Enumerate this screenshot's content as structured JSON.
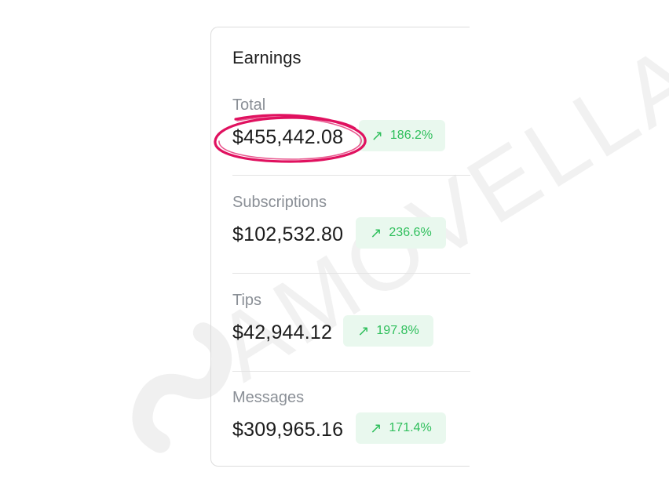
{
  "watermark": {
    "text": "AMOVELLA",
    "color": "#f2f2f2"
  },
  "card": {
    "title": "Earnings",
    "sections": [
      {
        "label": "Total",
        "amount": "$455,442.08",
        "change": "186.2%",
        "icon": "arrow-up-right-icon"
      },
      {
        "label": "Subscriptions",
        "amount": "$102,532.80",
        "change": "236.6%",
        "icon": "arrow-up-right-icon"
      },
      {
        "label": "Tips",
        "amount": "$42,944.12",
        "change": "197.8%",
        "icon": "arrow-up-right-icon"
      },
      {
        "label": "Messages",
        "amount": "$309,965.16",
        "change": "171.4%",
        "icon": "arrow-up-right-icon"
      }
    ]
  },
  "colors": {
    "positive": "#2fbf5c",
    "positive_bg": "#e9f8ee",
    "annotation": "#e0115f"
  }
}
